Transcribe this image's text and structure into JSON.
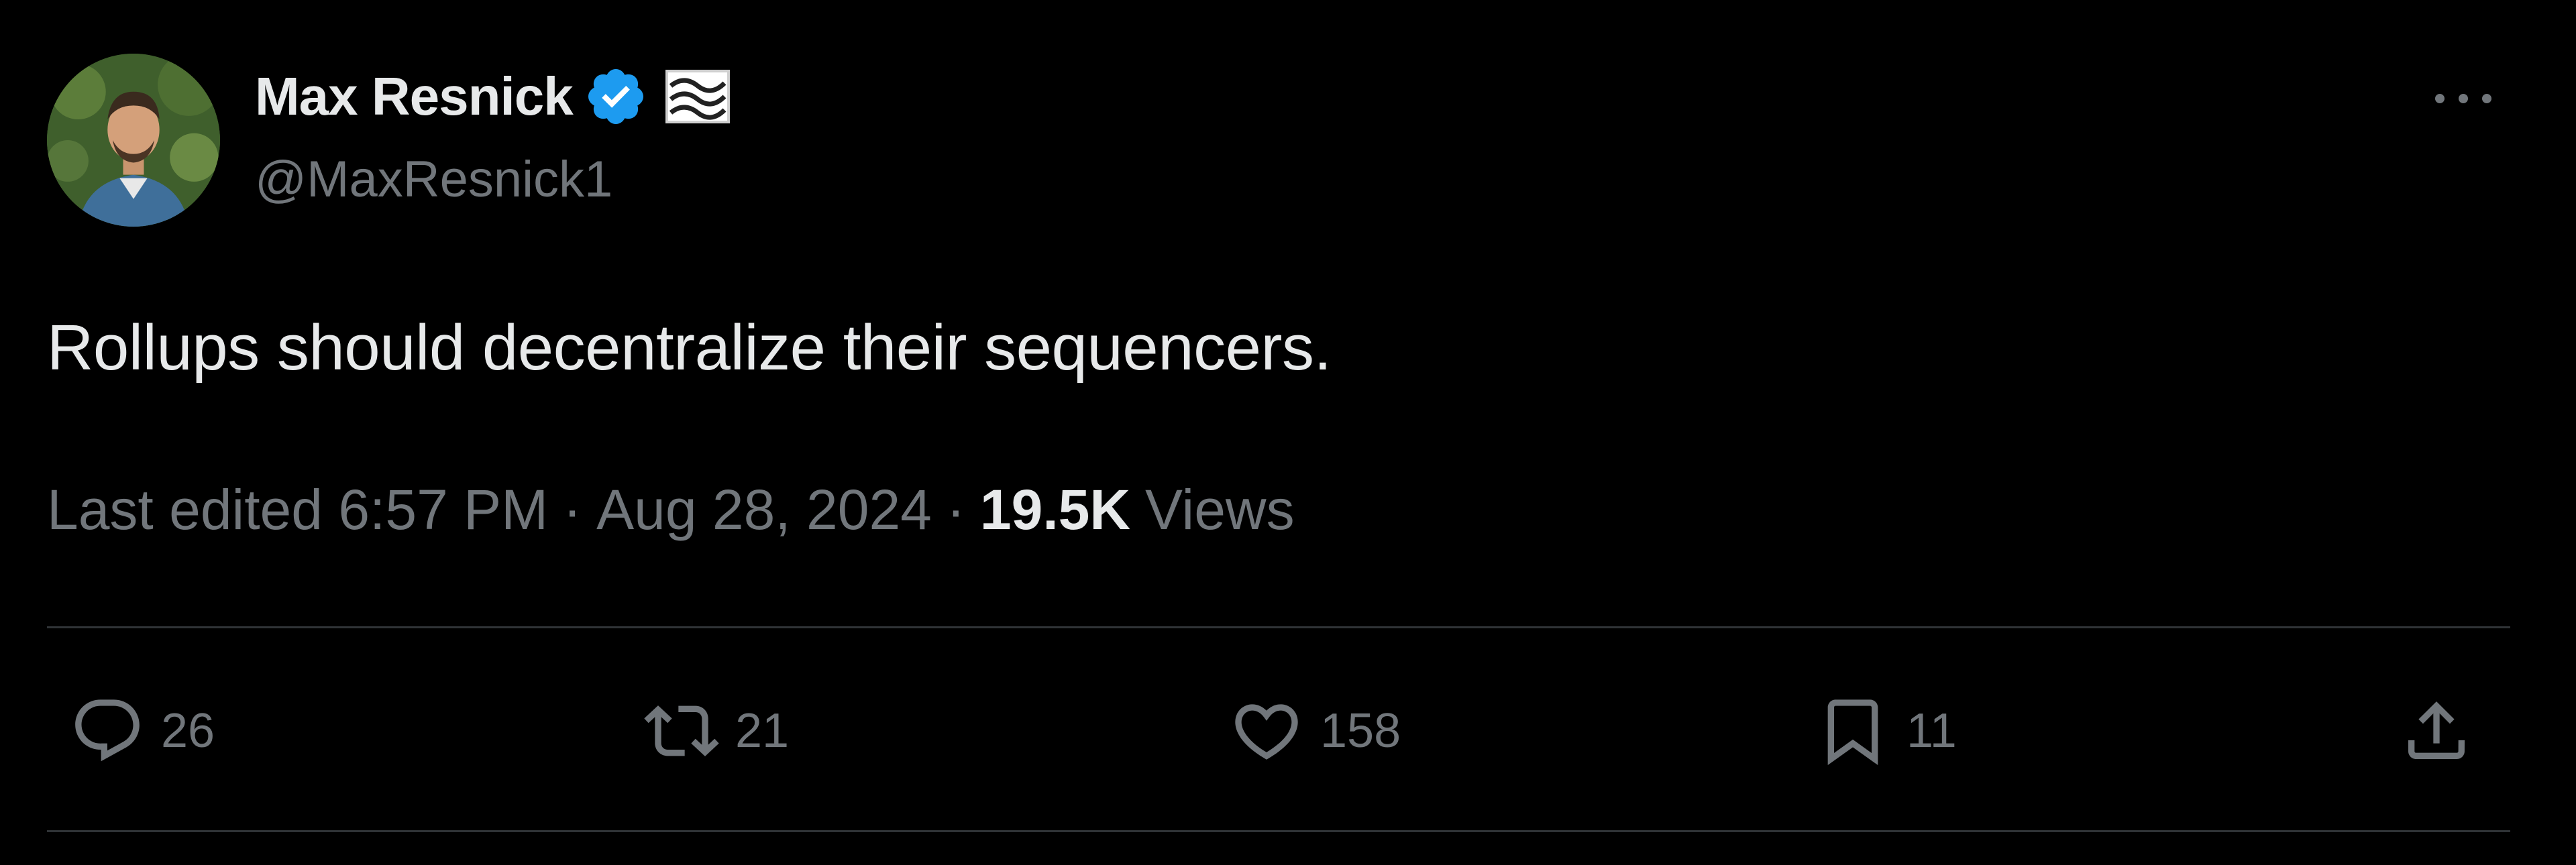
{
  "author": {
    "display_name": "Max Resnick",
    "handle": "@MaxResnick1",
    "verified_icon": "verified-badge-icon",
    "affiliate_icon": "affiliate-logo-icon"
  },
  "tweet": {
    "text": "Rollups should decentralize their sequencers.",
    "edited_label": "Last edited 6:57 PM",
    "date": "Aug 28, 2024",
    "separator": "·",
    "views_count": "19.5K",
    "views_label": "Views"
  },
  "actions": {
    "reply_count": "26",
    "retweet_count": "21",
    "like_count": "158",
    "bookmark_count": "11"
  },
  "colors": {
    "background": "#000000",
    "primary_text": "#e7e9ea",
    "secondary_text": "#71767b",
    "verified_blue": "#1d9bf0",
    "divider": "#2f3336"
  }
}
